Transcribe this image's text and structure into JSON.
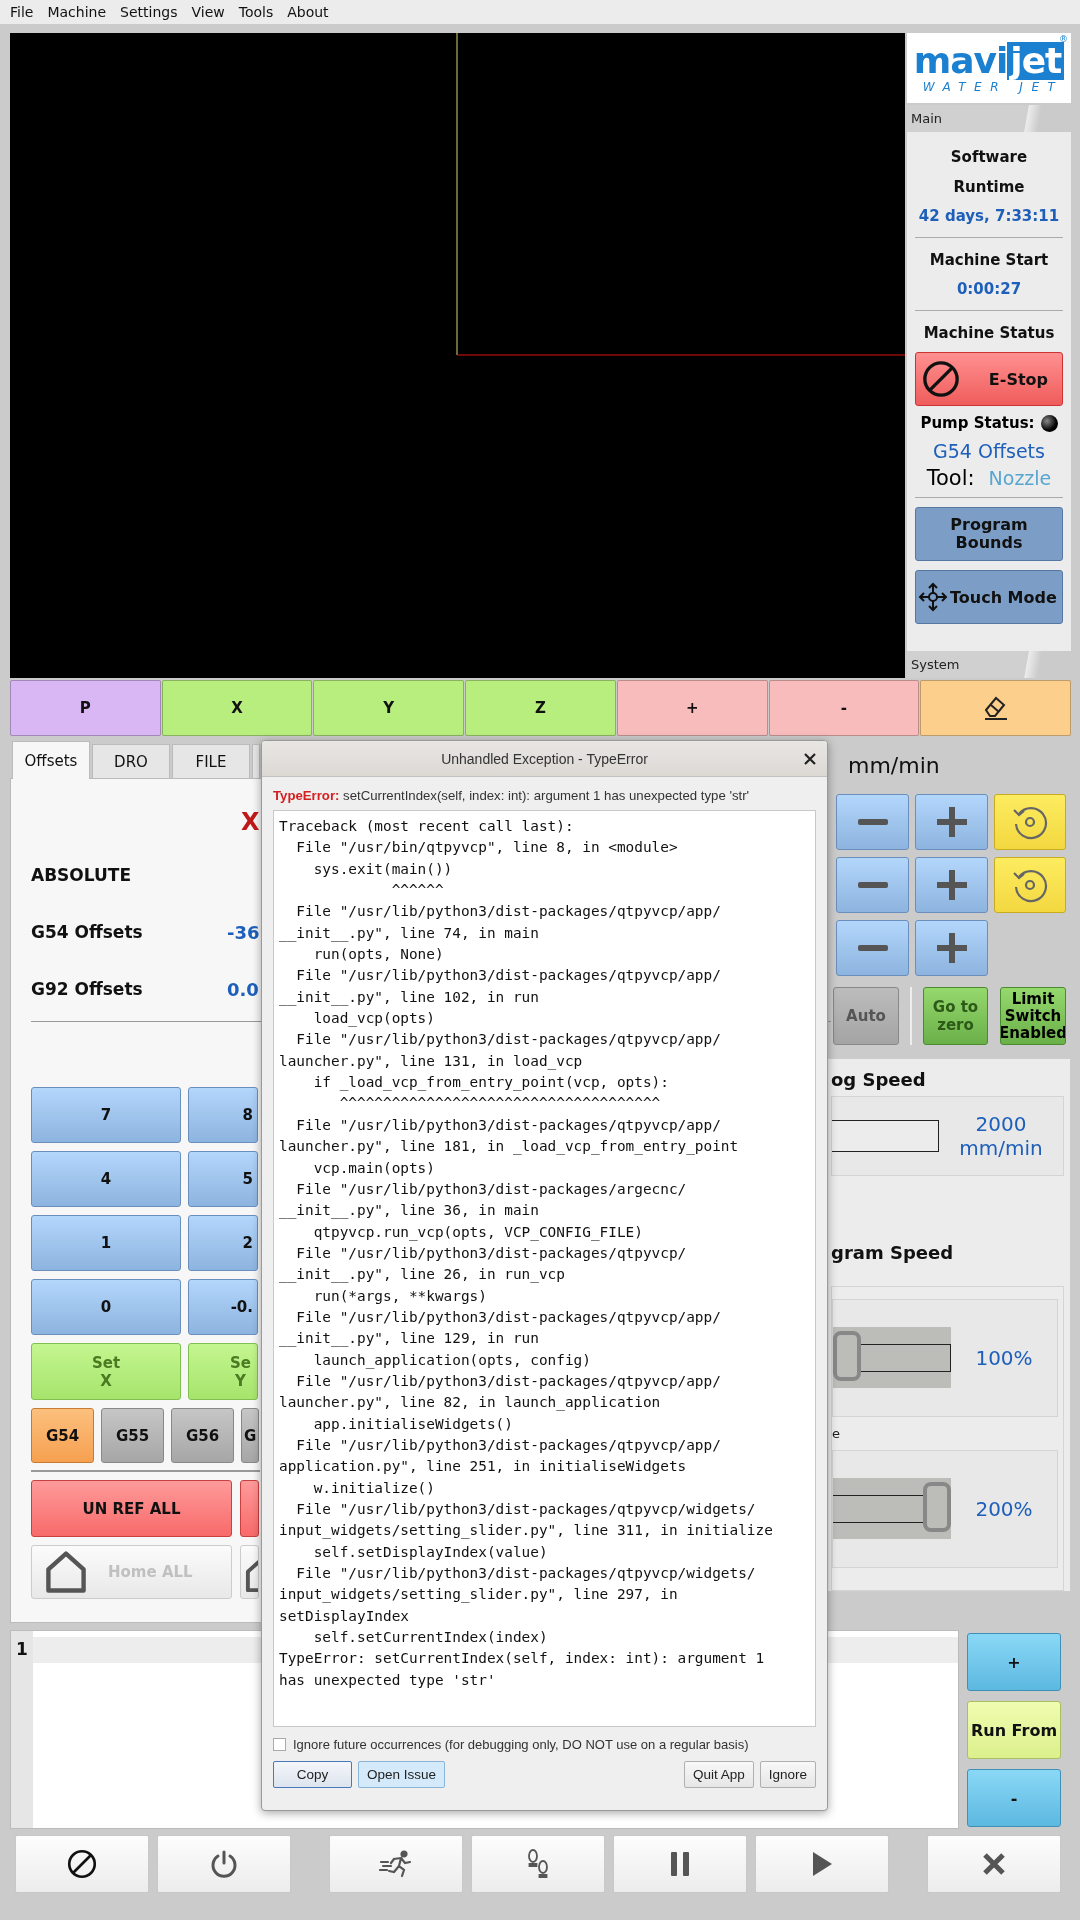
{
  "menu": [
    {
      "label": "File"
    },
    {
      "label": "Machine"
    },
    {
      "label": "Settings"
    },
    {
      "label": "View"
    },
    {
      "label": "Tools"
    },
    {
      "label": "About"
    }
  ],
  "logo": {
    "brand_left": "mavi",
    "brand_right": "jet",
    "registered": "®",
    "tagline": "WATER JET"
  },
  "status": {
    "main_tab": "Main",
    "runtime_label": "Software Runtime",
    "runtime": "42 days, 7:33:11",
    "machine_start_label": "Machine Start",
    "machine_start": "0:00:27",
    "machine_status_label": "Machine Status",
    "estop": "E-Stop",
    "pump_label": "Pump Status:",
    "pump_on": false,
    "offsets": "G54 Offsets",
    "tool_label": "Tool:",
    "tool": "Nozzle",
    "buttons": [
      {
        "label": "Program Bounds",
        "kind": "plain"
      },
      {
        "label": "Touch Mode",
        "kind": "move"
      }
    ],
    "system_tab": "System"
  },
  "jog_bar": [
    {
      "kind": "text",
      "label": "P",
      "color": "#d9b6f4"
    },
    {
      "kind": "text",
      "label": "X",
      "color": "#b8ee7e"
    },
    {
      "kind": "text",
      "label": "Y",
      "color": "#b8ee7e"
    },
    {
      "kind": "text",
      "label": "Z",
      "color": "#b8ee7e"
    },
    {
      "kind": "text",
      "label": "+",
      "color": "#f8bcbc"
    },
    {
      "kind": "text",
      "label": "-",
      "color": "#f8bcbc"
    },
    {
      "kind": "eraser",
      "color": "#fcd08c"
    }
  ],
  "left_tabs": [
    {
      "label": "Offsets",
      "selected": true
    },
    {
      "label": "DRO",
      "selected": false
    },
    {
      "label": "FILE",
      "selected": false
    }
  ],
  "axis_letter": "X",
  "offset_rows": [
    {
      "label": "ABSOLUTE"
    },
    {
      "label": "G54 Offsets",
      "value": "-36"
    },
    {
      "label": "G92 Offsets",
      "value": "0.0"
    }
  ],
  "keypad": [
    [
      "7",
      "8"
    ],
    [
      "4",
      "5"
    ],
    [
      "1",
      "2"
    ],
    [
      "0",
      "-0."
    ]
  ],
  "set_buttons": [
    [
      "Set",
      "X"
    ],
    [
      "Se",
      "Y"
    ]
  ],
  "coord_systems": [
    {
      "label": "G54",
      "selected": true
    },
    {
      "label": "G55",
      "selected": false
    },
    {
      "label": "G56",
      "selected": false
    },
    {
      "label": "G",
      "selected": false
    }
  ],
  "unref_all": "UN REF ALL",
  "home_all": {
    "label": "Home ALL",
    "disabled": true
  },
  "jog_units": "mm/min",
  "jog_rows": [
    {
      "reset": true
    },
    {
      "reset": true
    },
    {
      "reset": false
    }
  ],
  "auto": {
    "label": "Auto",
    "disabled": true
  },
  "go_to_zero": "Go to zero",
  "limit_switch": "Limit Switch Enabled",
  "jog_speed": {
    "title": "og Speed",
    "reading": "2000 mm/min"
  },
  "program_speed": {
    "title": "gram Speed",
    "overrides": [
      {
        "level": 0,
        "reading": "100%"
      },
      {
        "label": "e",
        "level": 1,
        "reading": "200%"
      }
    ]
  },
  "editor": {
    "line_numbers": [
      "1"
    ]
  },
  "side_buttons": [
    {
      "kind": "step",
      "label": "+"
    },
    {
      "kind": "run",
      "label": "Run From"
    },
    {
      "kind": "step",
      "label": "-"
    }
  ],
  "action_groups": [
    [
      {
        "kind": "stop"
      },
      {
        "kind": "power"
      }
    ],
    [
      {
        "kind": "run"
      },
      {
        "kind": "step"
      },
      {
        "kind": "pause"
      },
      {
        "kind": "play"
      }
    ],
    [
      {
        "kind": "abort"
      }
    ]
  ],
  "dialog": {
    "title": "Unhandled Exception - TypeError",
    "error_line": "**TypeError:** setCurrentIndex(self, index: int): argument 1 has unexpected type 'str'",
    "traceback": [
      "Traceback (most recent call last):",
      "  File \"/usr/bin/qtpyvcp\", line 8, in <module>",
      "    sys.exit(main())",
      "             ^^^^^^",
      "  File \"/usr/lib/python3/dist-packages/qtpyvcp/app/",
      "__init__.py\", line 74, in main",
      "    run(opts, None)",
      "  File \"/usr/lib/python3/dist-packages/qtpyvcp/app/",
      "__init__.py\", line 102, in run",
      "    load_vcp(opts)",
      "  File \"/usr/lib/python3/dist-packages/qtpyvcp/app/",
      "launcher.py\", line 131, in load_vcp",
      "    if _load_vcp_from_entry_point(vcp, opts):",
      "       ^^^^^^^^^^^^^^^^^^^^^^^^^^^^^^^^^^^^^",
      "  File \"/usr/lib/python3/dist-packages/qtpyvcp/app/",
      "launcher.py\", line 181, in _load_vcp_from_entry_point",
      "    vcp.main(opts)",
      "  File \"/usr/lib/python3/dist-packages/argecnc/",
      "__init__.py\", line 36, in main",
      "    qtpyvcp.run_vcp(opts, VCP_CONFIG_FILE)",
      "  File \"/usr/lib/python3/dist-packages/qtpyvcp/",
      "__init__.py\", line 26, in run_vcp",
      "    run(*args, **kwargs)",
      "  File \"/usr/lib/python3/dist-packages/qtpyvcp/app/",
      "__init__.py\", line 129, in run",
      "    launch_application(opts, config)",
      "  File \"/usr/lib/python3/dist-packages/qtpyvcp/app/",
      "launcher.py\", line 82, in launch_application",
      "    app.initialiseWidgets()",
      "  File \"/usr/lib/python3/dist-packages/qtpyvcp/app/",
      "application.py\", line 251, in initialiseWidgets",
      "    w.initialize()",
      "  File \"/usr/lib/python3/dist-packages/qtpyvcp/widgets/",
      "input_widgets/setting_slider.py\", line 311, in initialize",
      "    self.setDisplayIndex(value)",
      "  File \"/usr/lib/python3/dist-packages/qtpyvcp/widgets/",
      "input_widgets/setting_slider.py\", line 297, in",
      "setDisplayIndex",
      "    self.setCurrentIndex(index)",
      "TypeError: setCurrentIndex(self, index: int): argument 1",
      "has unexpected type 'str'"
    ],
    "ignore_future": {
      "label": "Ignore future occurrences (for debugging only, DO NOT use on a regular basis)",
      "checked": false
    },
    "buttons": [
      {
        "label": "Copy",
        "kind": "default"
      },
      {
        "label": "Open Issue",
        "kind": "highlighted"
      },
      {
        "label": "Quit App",
        "kind": "plain"
      },
      {
        "label": "Ignore",
        "kind": "plain"
      }
    ]
  }
}
